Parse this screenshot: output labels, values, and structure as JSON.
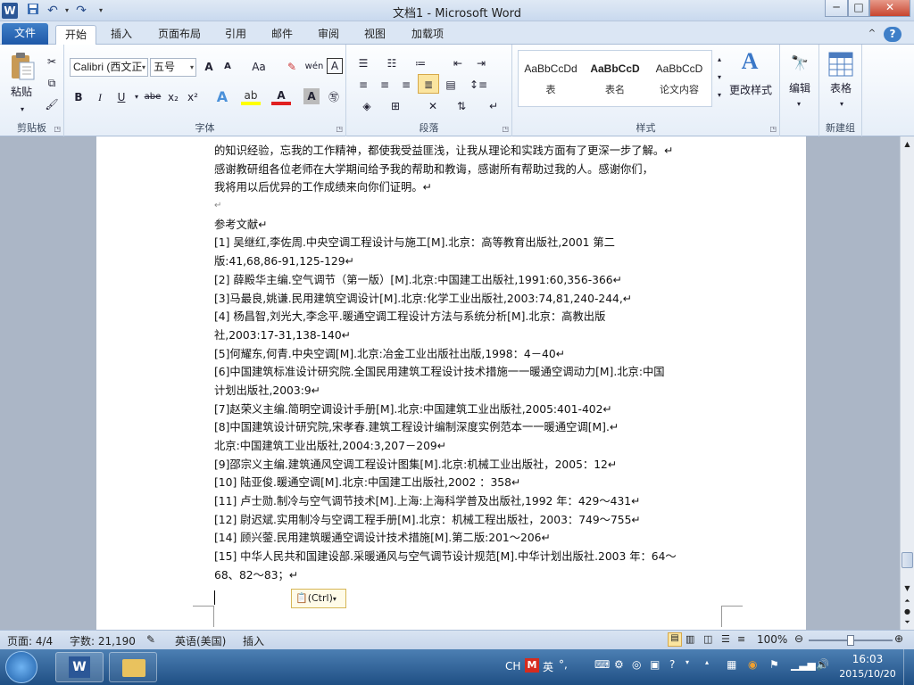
{
  "window": {
    "title": "文档1 - Microsoft Word"
  },
  "qat": {
    "app_icon": "W",
    "save_icon": "save-icon",
    "undo_icon": "undo-icon",
    "redo_icon": "redo-icon",
    "minimize": "─",
    "maximize": "□",
    "close": "✕"
  },
  "tabs": [
    {
      "label": "文件"
    },
    {
      "label": "开始"
    },
    {
      "label": "插入"
    },
    {
      "label": "页面布局"
    },
    {
      "label": "引用"
    },
    {
      "label": "邮件"
    },
    {
      "label": "审阅"
    },
    {
      "label": "视图"
    },
    {
      "label": "加载项"
    }
  ],
  "ribbon": {
    "clipboard": {
      "label": "剪贴板",
      "paste": "粘贴"
    },
    "font": {
      "label": "字体",
      "font_name": "Calibri (西文正",
      "font_size": "五号",
      "grow": "A",
      "shrink": "A",
      "case": "Aa",
      "bold": "B",
      "italic": "I",
      "underline": "U",
      "strike": "abe",
      "sub": "x₂",
      "sup": "x²",
      "color_a": "A",
      "wen": "wén",
      "char_border": "A"
    },
    "paragraph": {
      "label": "段落"
    },
    "styles": {
      "label": "样式",
      "items": [
        {
          "preview": "AaBbCcDd",
          "name": "表"
        },
        {
          "preview": "AaBbCcD",
          "name": "表名"
        },
        {
          "preview": "AaBbCcD",
          "name": "论文内容"
        }
      ],
      "change_styles": "更改样式"
    },
    "editing": {
      "label": "编辑"
    },
    "tables": {
      "label": "新建组",
      "table": "表格"
    }
  },
  "document": {
    "lines": [
      "的知识经验，忘我的工作精神，都使我受益匪浅，让我从理论和实践方面有了更深一步了解。↵",
      "感谢教研组各位老师在大学期间给予我的帮助和教诲，感谢所有帮助过我的人。感谢你们，",
      "我将用以后优异的工作成绩来向你们证明。↵",
      "↵",
      "参考文献↵",
      "[1]  吴继红,李佐周.中央空调工程设计与施工[M].北京：高等教育出版社,2001  第二",
      "版:41,68,86-91,125-129↵",
      "[2]  薛殿华主编.空气调节（第一版）[M].北京:中国建工出版社,1991:60,356-366↵",
      "[3]马最良,姚谦.民用建筑空调设计[M].北京:化学工业出版社,2003:74,81,240-244,↵",
      "[4] 杨昌智,刘光大,李念平.暖通空调工程设计方法与系统分析[M].北京：高教出版",
      "社,2003:17-31,138-140↵",
      "[5]何耀东,何青.中央空调[M].北京:冶金工业出版社出版,1998：4－40↵",
      "[6]中国建筑标准设计研究院.全国民用建筑工程设计技术措施一一暖通空调动力[M].北京:中国",
      "计划出版社,2003:9↵",
      "[7]赵荣义主编.简明空调设计手册[M].北京:中国建筑工业出版社,2005:401-402↵",
      "[8]中国建筑设计研究院,宋孝春.建筑工程设计编制深度实例范本一一暖通空调[M].↵",
      "北京:中国建筑工业出版社,2004:3,207－209↵",
      "[9]邵宗义主编.建筑通风空调工程设计图集[M].北京:机械工业出版社，2005：12↵",
      "[10]  陆亚俊.暖通空调[M].北京:中国建工出版社,2002  ：358↵",
      "[11]  卢士勋.制冷与空气调节技术[M].上海:上海科学普及出版社,1992 年：429～431↵",
      "[12]  尉迟斌.实用制冷与空调工程手册[M].北京：机械工程出版社，2003：749～755↵",
      "[14]  顾兴蓥.民用建筑暖通空调设计技术措施[M].第二版:201～206↵",
      "[15]  中华人民共和国建设部.采暖通风与空气调节设计规范[M].中华计划出版社.2003 年：64～",
      "68、82～83；↵"
    ],
    "paste_tag": "(Ctrl)"
  },
  "status": {
    "page": "页面: 4/4",
    "words": "字数: 21,190",
    "language": "英语(美国)",
    "insert": "插入",
    "zoom": "100%",
    "zoom_level": 1.0
  },
  "taskbar": {
    "ime": "CH",
    "ime_mode": "英",
    "time": "16:03",
    "date": "2015/10/20"
  }
}
